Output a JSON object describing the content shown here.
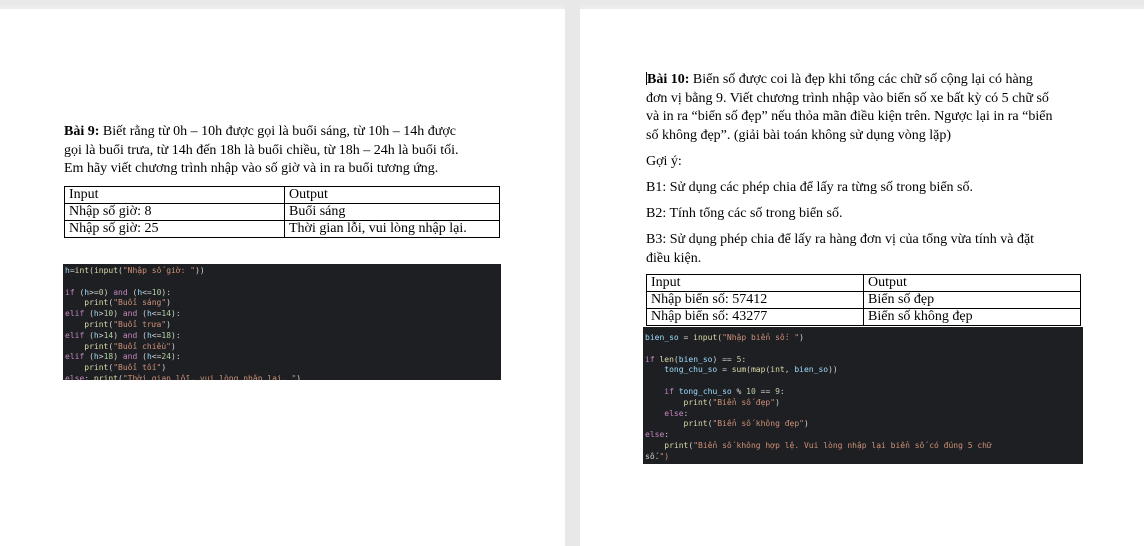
{
  "left_page": {
    "bai9": {
      "title": "Bài 9:",
      "text_lines": [
        "Biết rằng từ 0h – 10h được gọi là buổi sáng, từ 10h – 14h được",
        "gọi là buổi trưa, từ 14h đến 18h là buổi chiều, từ 18h – 24h là buổi tối.",
        "Em hãy viết chương trình nhập vào số giờ và in ra buổi tương ứng."
      ],
      "table": {
        "headers": [
          "Input",
          "Output"
        ],
        "rows": [
          [
            "Nhập số giờ: 8",
            "Buổi sáng"
          ],
          [
            "Nhập số giờ: 25",
            "Thời gian lỗi, vui lòng nhập lại."
          ]
        ]
      },
      "code_lines": [
        "h=int(input(\"Nhập số giờ: \"))",
        "",
        "if (h>=0) and (h<=10):",
        "    print(\"Buổi sáng\")",
        "elif (h>10) and (h<=14):",
        "    print(\"Buổi trưa\")",
        "elif (h>14) and (h<=18):",
        "    print(\"Buổi chiều\")",
        "elif (h>18) and (h<=24):",
        "    print(\"Buổi tối\")",
        "else: print(\"Thời gian lỗi, vui lòng nhập lại. \")"
      ]
    }
  },
  "right_page": {
    "bai10": {
      "title": "Bài 10:",
      "text_lines": [
        "Biển số được coi là đẹp khi tổng các chữ số cộng lại có hàng",
        "đơn vị bằng 9. Viết chương trình nhập vào biển số xe bất kỳ có 5 chữ số",
        "và in ra “biển số đẹp” nếu thỏa mãn điều kiện trên. Ngược lại in ra “biển",
        "số không đẹp”. (giải bài toán không sử dụng vòng lặp)"
      ],
      "hint_label": "Gợi ý:",
      "b1": "B1: Sử dụng các phép chia để lấy ra từng số trong biển số.",
      "b2": "B2: Tính tổng các số trong biển số.",
      "b3_lines": [
        "B3: Sử dụng phép chia để lấy ra hàng đơn vị của tổng vừa tính và đặt",
        "điều kiện."
      ],
      "table": {
        "headers": [
          "Input",
          "Output"
        ],
        "rows": [
          [
            "Nhập biển số: 57412",
            "Biển số đẹp"
          ],
          [
            "Nhập biển số: 43277",
            "Biển số không đẹp"
          ]
        ]
      },
      "code_lines": [
        "bien_so = input(\"Nhập biển số: \")",
        "",
        "if len(bien_so) == 5:",
        "    tong_chu_so = sum(map(int, bien_so))",
        "",
        "    if tong_chu_so % 10 == 9:",
        "        print(\"Biển số đẹp\")",
        "    else:",
        "        print(\"Biển số không đẹp\")",
        "else:",
        "    print(\"Biển số không hợp lệ. Vui lòng nhập lại biển số có đúng 5 chữ",
        "số.\")"
      ]
    }
  }
}
